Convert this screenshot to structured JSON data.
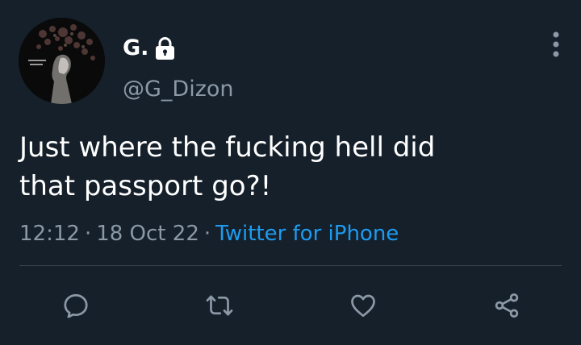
{
  "author": {
    "display_name": "G.",
    "handle": "@G_Dizon",
    "protected_icon": "lock-icon"
  },
  "tweet": {
    "text_line_1": "Just where the fucking hell did",
    "text_line_2": "that passport go?!",
    "time": "12:12",
    "separator": "·",
    "date": "18 Oct 22",
    "source": "Twitter for iPhone"
  },
  "actions": {
    "reply_icon": "reply-icon",
    "retweet_icon": "retweet-icon",
    "like_icon": "like-icon",
    "share_icon": "share-icon"
  },
  "colors": {
    "background": "#15202b",
    "text_primary": "#ffffff",
    "text_secondary": "#8b98a5",
    "accent": "#1d9bf0",
    "divider": "#38444d"
  }
}
